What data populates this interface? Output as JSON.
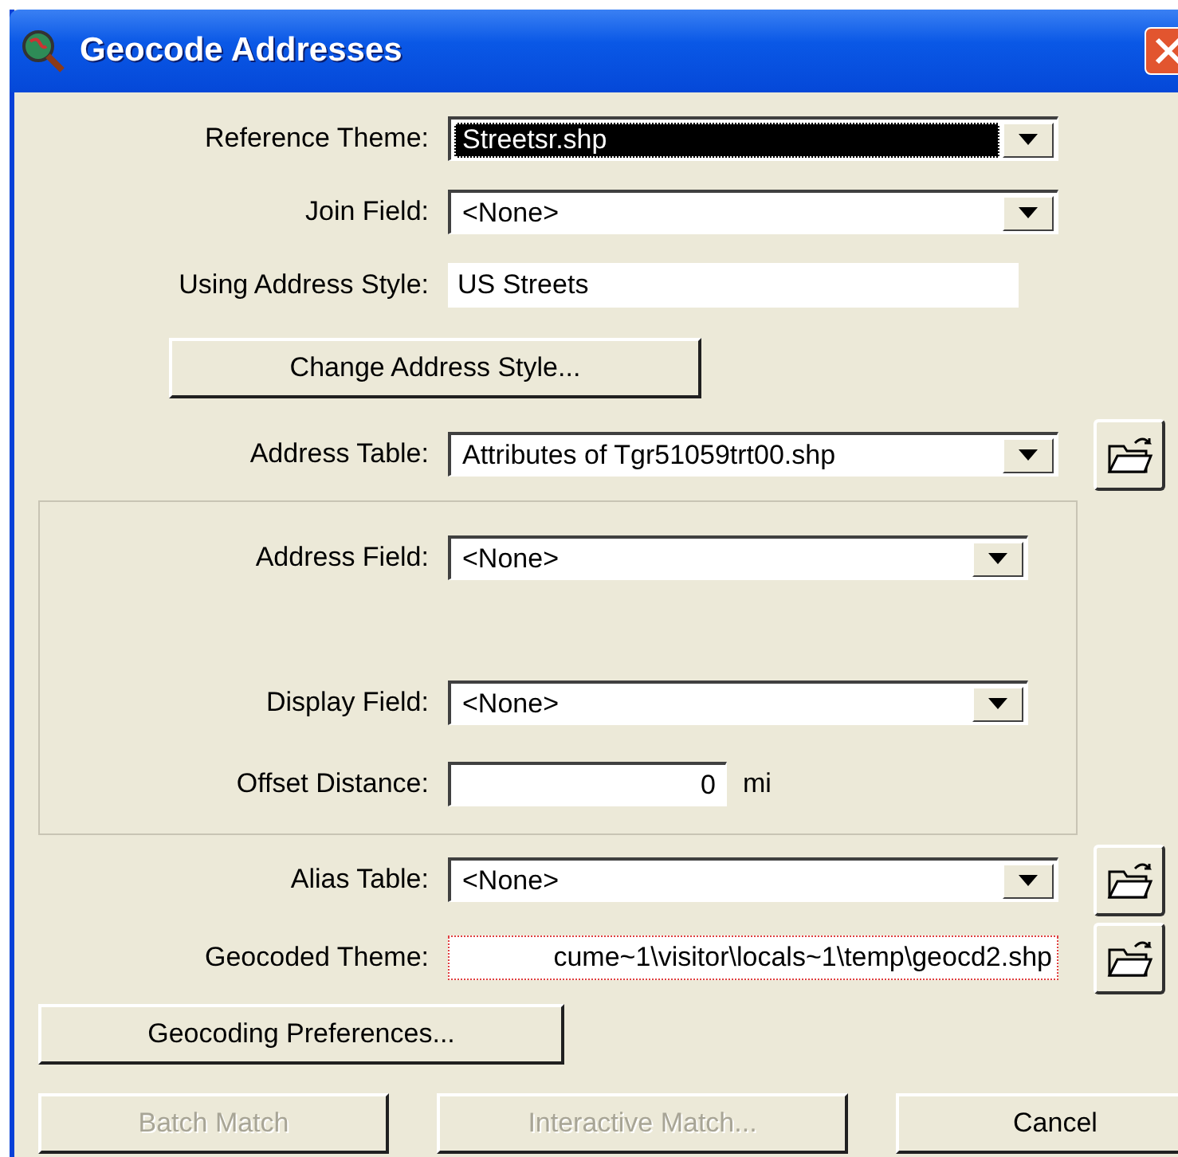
{
  "window": {
    "title": "Geocode Addresses"
  },
  "top_fields": [
    {
      "kind": "dropdown",
      "label": "Reference Theme:",
      "value": "Streetsr.shp",
      "focused": true
    },
    {
      "kind": "dropdown",
      "label": "Join Field:",
      "value": "<None>",
      "focused": false
    },
    {
      "kind": "readonly",
      "label": "Using Address Style:",
      "value": "US Streets"
    }
  ],
  "change_style_button": "Change Address Style...",
  "address_table": {
    "kind": "dropdown",
    "label": "Address Table:",
    "value": "Attributes of Tgr51059trt00.shp",
    "focused": false
  },
  "group_fields": [
    {
      "kind": "dropdown",
      "label": "Address Field:",
      "value": "<None>",
      "focused": false
    },
    {
      "kind": "dropdown",
      "label": "Display Field:",
      "value": "<None>",
      "focused": false
    },
    {
      "kind": "number",
      "label": "Offset Distance:",
      "value": "0",
      "unit": "mi"
    }
  ],
  "lower_fields": [
    {
      "kind": "dropdown",
      "label": "Alias Table:",
      "value": "<None>",
      "focused": false
    },
    {
      "kind": "path",
      "label": "Geocoded Theme:",
      "value": "cume~1\\visitor\\locals~1\\temp\\geocd2.shp"
    }
  ],
  "preferences_button": "Geocoding Preferences...",
  "buttons": [
    {
      "label": "Batch Match",
      "disabled": true
    },
    {
      "label": "Interactive Match...",
      "disabled": true
    },
    {
      "label": "Cancel",
      "disabled": false
    }
  ]
}
